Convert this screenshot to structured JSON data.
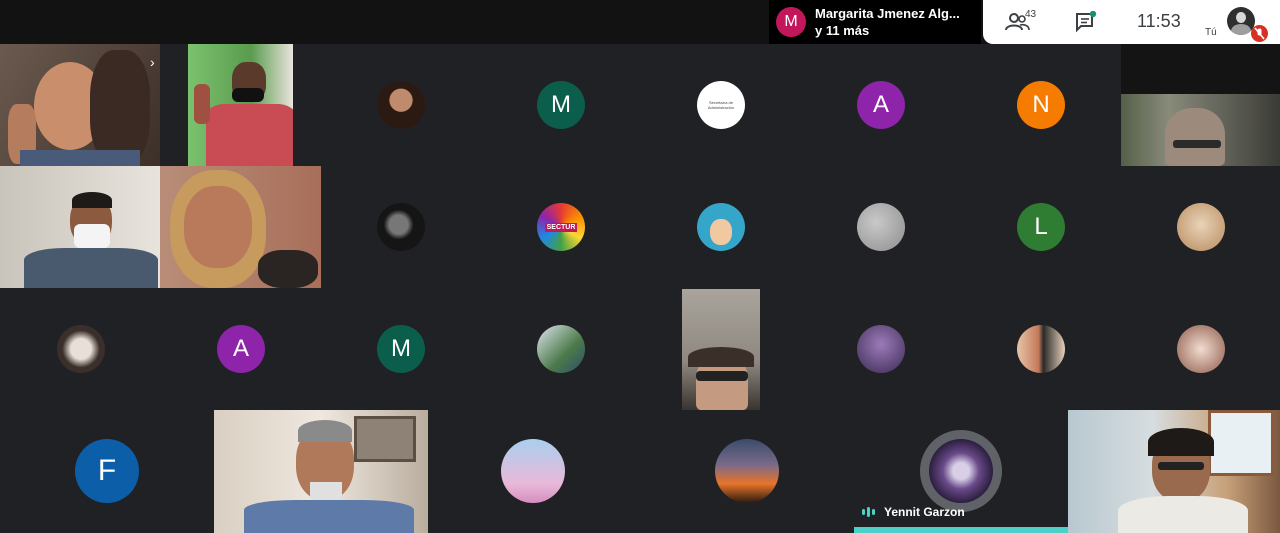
{
  "presenter": {
    "initial": "M",
    "name": "Margarita Jmenez Alg...",
    "more": "y 11 más",
    "color": "#c2185b"
  },
  "toolbar": {
    "participants_count": "43",
    "time": "11:53",
    "self_label": "Tú"
  },
  "tiles": {
    "r1c3_initial": "",
    "r1c4_initial": "M",
    "r1c6_initial": "A",
    "r1c7_initial": "N",
    "r2c7_initial": "L",
    "r3c2_initial": "A",
    "r3c3_initial": "M",
    "r4c1_initial": "F",
    "sectur_text": "SECTUR",
    "admin_text": "Secretaría de Administración"
  },
  "active_speaker": {
    "name": "Yennit Garzon"
  },
  "colors": {
    "teal_m": "#0b5e4b",
    "purple": "#8e24aa",
    "orange": "#f57c00",
    "green": "#2e7d32",
    "blue": "#0d5ea8"
  }
}
